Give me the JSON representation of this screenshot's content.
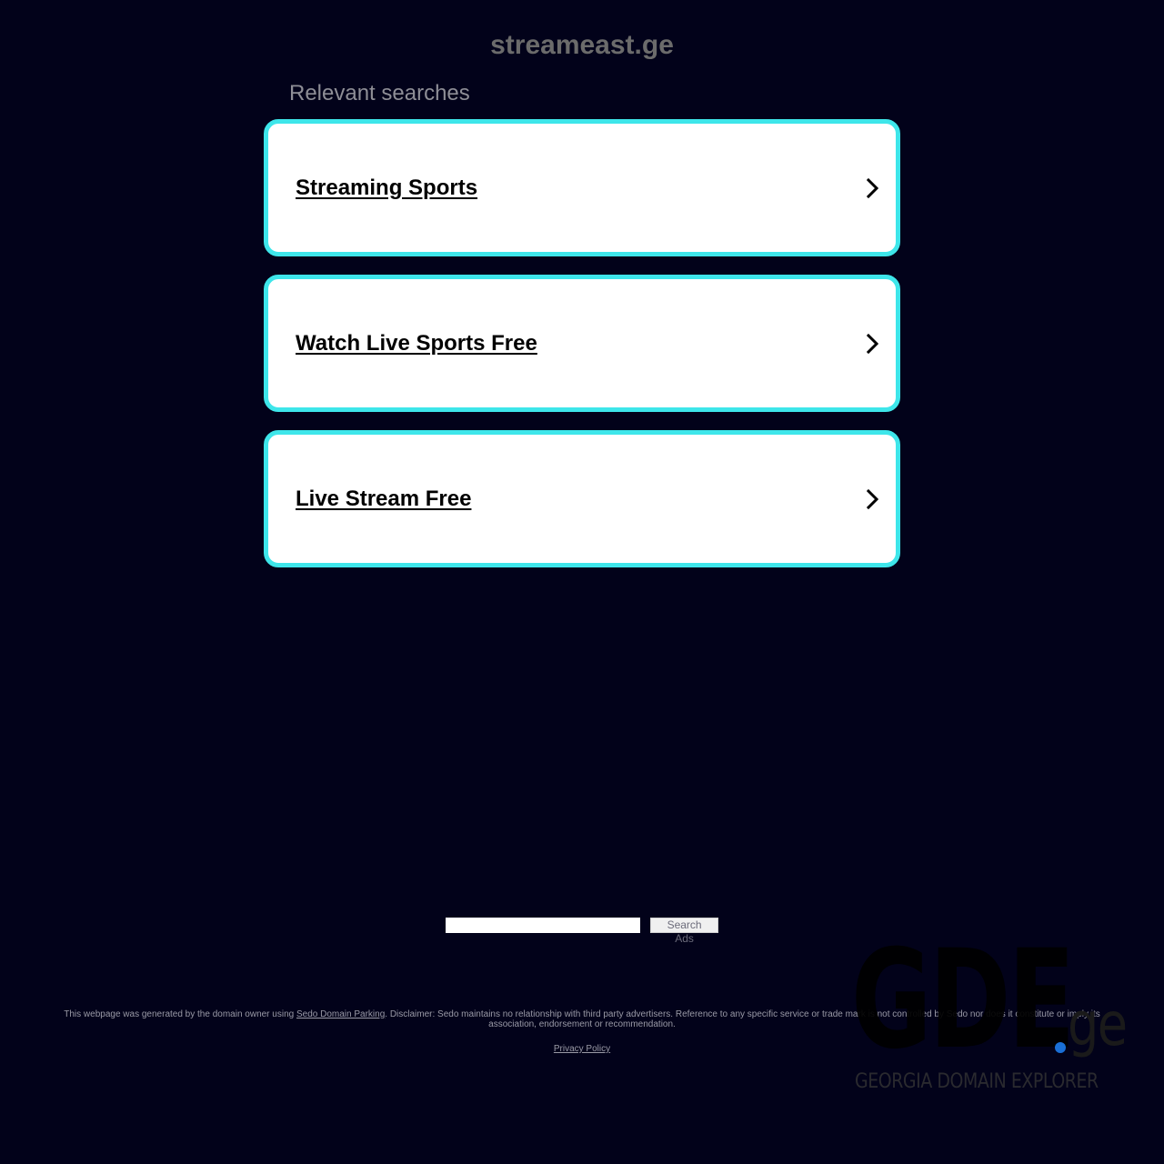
{
  "header": {
    "domain": "streameast.ge",
    "relevant_heading": "Relevant searches"
  },
  "colors": {
    "background": "#02021a",
    "card_border": "#3ee6ea",
    "card_bg": "#ffffff",
    "logo_dot": "#1a6fd6"
  },
  "searches": [
    {
      "label": "Streaming Sports",
      "icon": "chevron-right-icon"
    },
    {
      "label": "Watch Live Sports Free",
      "icon": "chevron-right-icon"
    },
    {
      "label": "Live Stream Free",
      "icon": "chevron-right-icon"
    }
  ],
  "search_ads": {
    "input_value": "",
    "button_label": "Search Ads"
  },
  "footer": {
    "disclaimer_prefix": "This webpage was generated by the domain owner using ",
    "sedo_link": "Sedo Domain Parking",
    "disclaimer_suffix": ". Disclaimer: Sedo maintains no relationship with third party advertisers. Reference to any specific service or trade mark is not controlled by Sedo nor does it constitute or imply its association, endorsement or recommendation.",
    "privacy_policy": "Privacy Policy"
  },
  "logo": {
    "main": "GDE",
    "tld": "ge",
    "tagline": "GEORGIA DOMAIN EXPLORER"
  }
}
